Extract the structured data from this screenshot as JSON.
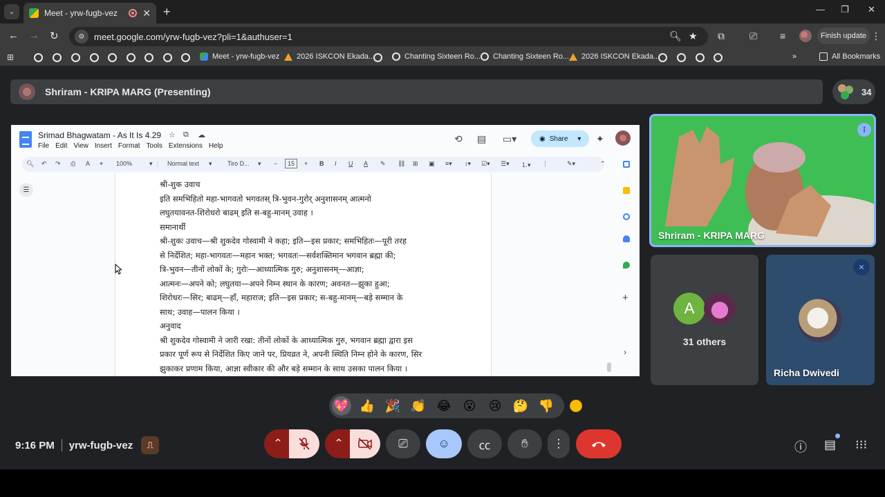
{
  "browser": {
    "tab_title": "Meet - yrw-fugb-vez",
    "url": "meet.google.com/yrw-fugb-vez?pli=1&authuser=1",
    "finish_update": "Finish update",
    "window_controls": {
      "minimize": "—",
      "maximize": "❐",
      "close": "✕"
    },
    "new_tab": "+",
    "close_tab": "✕"
  },
  "bookmarks": {
    "items": [
      {
        "label": "Meet - yrw-fugb-vez",
        "icon": "meet-icon"
      },
      {
        "label": "2026 ISKCON Ekada...",
        "icon": "warning-icon"
      },
      {
        "label": "Chanting Sixteen Ro...",
        "icon": "globe-icon"
      },
      {
        "label": "Chanting Sixteen Ro...",
        "icon": "globe-icon"
      },
      {
        "label": "2026 ISKCON Ekada...",
        "icon": "warning-icon"
      }
    ],
    "more": "»",
    "all_bookmarks": "All Bookmarks"
  },
  "meet": {
    "presenting_title": "Shriram - KRIPA MARG (Presenting)",
    "participant_count": "34",
    "main_tile_name": "Shriram - KRIPA MARG",
    "others_label": "31 others",
    "others_initial": "A",
    "richa_name": "Richa Dwivedi",
    "clock": "9:16 PM",
    "meeting_code": "yrw-fugb-vez",
    "accent_color": "#8ab4f8",
    "end_call_color": "#dc362e"
  },
  "doc": {
    "title": "Srimad Bhagwatam - As It Is 4.29",
    "menu": [
      "File",
      "Edit",
      "View",
      "Insert",
      "Format",
      "Tools",
      "Extensions",
      "Help"
    ],
    "share_label": "Share",
    "zoom": "100%",
    "style": "Normal text",
    "font": "Tiro D...",
    "font_size": "15",
    "lines": [
      "श्री-शुक उवाच",
      "इति समभिहितो महा-भागवतो भगवतस् त्रि-भुवन-गुरोर् अनुशासनम् आत्मनो",
      "लघुतयावनत-शिरोधरो बाढम् इति स-बहु-मानम् उवाह ।",
      "समानार्थी",
      "श्री-शुकः उवाच—श्री शुकदेव गोस्वामी ने कहा; इति—इस प्रकार; समभिहितः—पूरी तरह",
      "से निर्देशित; महा-भागवतः—महान भक्त; भगवतः—सर्वशक्तिमान भगवान ब्रह्मा की;",
      "त्रि-भुवन—तीनों लोकों के; गुरोः—आध्यात्मिक गुरु; अनुशासनम्—आज्ञा;",
      "आत्मनः—अपने को; लघुतया—अपने निम्न स्थान के कारण; अवनत—झुका हुआ;",
      "शिरोधरः—सिर; बाढम्—हाँ, महाराज; इति—इस प्रकार; स-बहु-मानम्—बड़े सम्मान के",
      "साथ; उवाह—पालन किया ।",
      "अनुवाद",
      "श्री शुकदेव गोस्वामी ने जारी रखा: तीनों लोकों के आध्यात्मिक गुरु, भगवान ब्रह्मा द्वारा इस",
      "प्रकार पूर्ण रूप से निर्देशित किए जाने पर, प्रियव्रत ने, अपनी स्थिति निम्न होने के कारण, सिर",
      "झुकाकर प्रणाम किया, आज्ञा स्वीकार की और बड़े सम्मान के साथ उसका पालन किया ।"
    ]
  },
  "reactions": [
    "💖",
    "👍",
    "🎉",
    "👏",
    "😂",
    "😮",
    "😢",
    "🤔",
    "👎"
  ]
}
